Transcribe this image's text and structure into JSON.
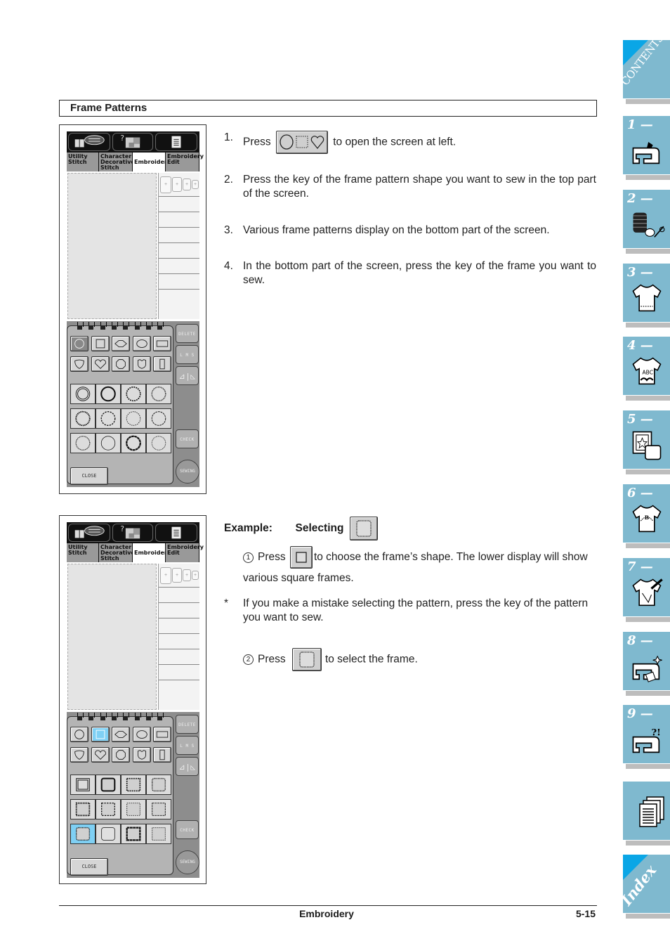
{
  "section": {
    "title": "Frame Patterns"
  },
  "screen": {
    "tabs": [
      {
        "label_lines": [
          "Utility",
          "Stitch"
        ]
      },
      {
        "label_lines": [
          "Character",
          "Decorative",
          "Stitch"
        ]
      },
      {
        "label_lines": [
          "Embroidery"
        ]
      },
      {
        "label_lines": [
          "Embroidery",
          "Edit"
        ]
      }
    ],
    "hoop_sizes": [
      "+",
      "+",
      "+",
      "+"
    ],
    "buttons": {
      "delete": "DELETE",
      "size": "L M S",
      "mirror": "⊿|◺",
      "check": "CHECK",
      "close": "CLOSE",
      "sewing": "SEWING"
    },
    "shapes_row1": [
      "circle",
      "square",
      "diamond",
      "oval",
      "rectangle"
    ],
    "shapes_row2": [
      "shield",
      "heart",
      "octagon",
      "crest",
      "tall-rectangle"
    ]
  },
  "screen1": {
    "selected_shape": "circle",
    "frames": [
      [
        "double-circle",
        "bold-circle",
        "dotted-circle",
        "scalloped-circle"
      ],
      [
        "beaded-circle",
        "dashed-circle",
        "zigzag-circle",
        "wavy-circle"
      ],
      [
        "stitched-circle",
        "plain-circle",
        "heavy-circle",
        "fine-circle"
      ]
    ]
  },
  "screen2": {
    "selected_shape": "square",
    "selected_frame": "scalloped-square",
    "frames": [
      [
        "double-square",
        "bold-square",
        "dotted-square",
        "scalloped-square"
      ],
      [
        "beaded-square",
        "dashed-square",
        "zigzag-square",
        "wavy-square"
      ],
      [
        "scalloped-square",
        "plain-square",
        "heavy-square",
        "fine-square"
      ]
    ]
  },
  "steps": [
    {
      "num": "1.",
      "before": "Press",
      "after": "to open the screen at left."
    },
    {
      "num": "2.",
      "text": "Press the key of the frame pattern shape you want to sew in the top part of the screen."
    },
    {
      "num": "3.",
      "text": "Various frame patterns display on the bottom part of the screen."
    },
    {
      "num": "4.",
      "text": "In the bottom part of the screen, press the key of the frame you want to sew."
    }
  ],
  "example": {
    "label": "Example:",
    "selecting": "Selecting",
    "sub1": {
      "marker": "1",
      "before": "Press",
      "after": "to choose the frame’s shape. The lower display will show various square frames."
    },
    "note": {
      "marker": "*",
      "text": "If you make a mistake selecting the pattern, press the key of the pattern you want to sew."
    },
    "sub2": {
      "marker": "2",
      "before": "Press",
      "after": "to select the frame."
    }
  },
  "footer": {
    "title": "Embroidery",
    "page": "5-15"
  },
  "sidebar": {
    "contents": "CONTENTS",
    "chapters": [
      "1 —",
      "2 —",
      "3 —",
      "4 —",
      "5 —",
      "6 —",
      "7 —",
      "8 —",
      "9 —"
    ],
    "index": "Index",
    "colors": {
      "tab": "#7fb9cf",
      "corner": "#0aa6e6",
      "shadow": "#bdbdbd"
    }
  }
}
